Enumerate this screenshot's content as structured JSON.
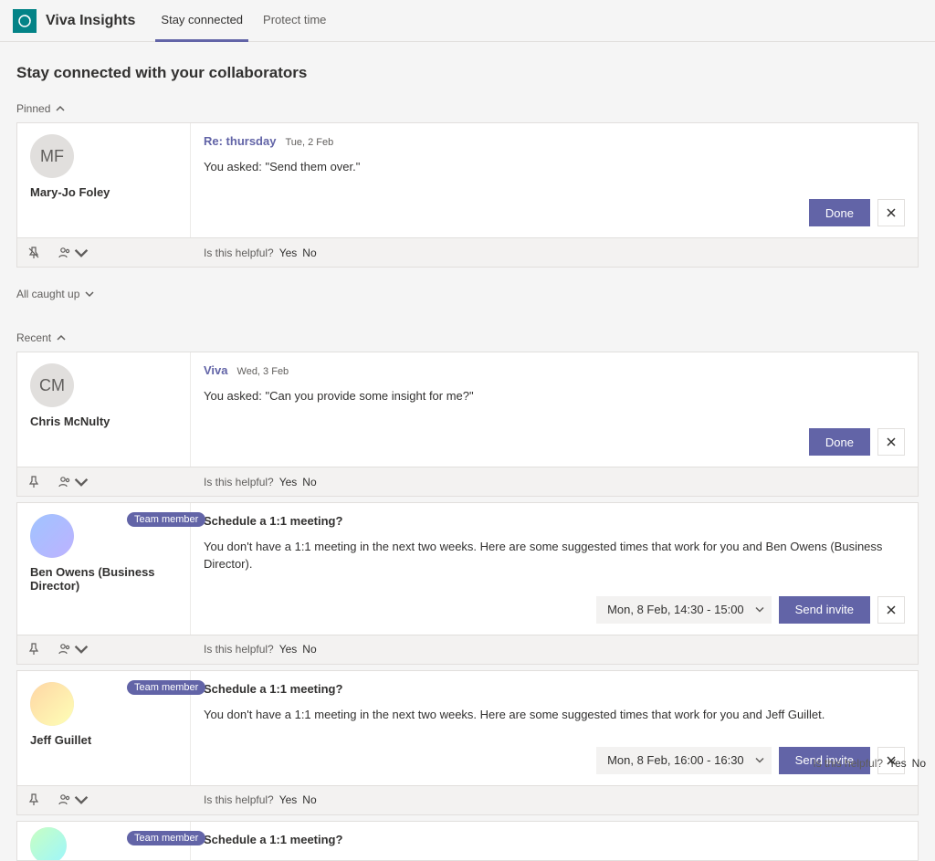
{
  "app": {
    "title": "Viva Insights"
  },
  "tabs": [
    {
      "label": "Stay connected",
      "active": true
    },
    {
      "label": "Protect time",
      "active": false
    }
  ],
  "page_heading": "Stay connected with your collaborators",
  "sections": {
    "pinned_label": "Pinned",
    "all_caught_up_label": "All caught up",
    "recent_label": "Recent"
  },
  "helpful": {
    "prompt": "Is this helpful?",
    "yes": "Yes",
    "no": "No"
  },
  "badge_team_member": "Team member",
  "buttons": {
    "done": "Done",
    "send_invite": "Send invite"
  },
  "cards": [
    {
      "initials": "MF",
      "name": "Mary-Jo Foley",
      "subject": "Re: thursday",
      "date": "Tue, 2 Feb",
      "body": "You asked: \"Send them over.\""
    },
    {
      "initials": "CM",
      "name": "Chris McNulty",
      "subject": "Viva",
      "date": "Wed, 3 Feb",
      "body": "You asked: \"Can you provide some insight for me?\""
    },
    {
      "name": "Ben Owens (Business Director)",
      "subject": "Schedule a 1:1 meeting?",
      "body": "You don't have a 1:1 meeting in the next two weeks. Here are some suggested times that work for you and Ben Owens (Business Director).",
      "time_option": "Mon, 8 Feb, 14:30 - 15:00"
    },
    {
      "name": "Jeff Guillet",
      "subject": "Schedule a 1:1 meeting?",
      "body": "You don't have a 1:1 meeting in the next two weeks. Here are some suggested times that work for you and Jeff Guillet.",
      "time_option": "Mon, 8 Feb, 16:00 - 16:30"
    },
    {
      "subject": "Schedule a 1:1 meeting?"
    }
  ]
}
